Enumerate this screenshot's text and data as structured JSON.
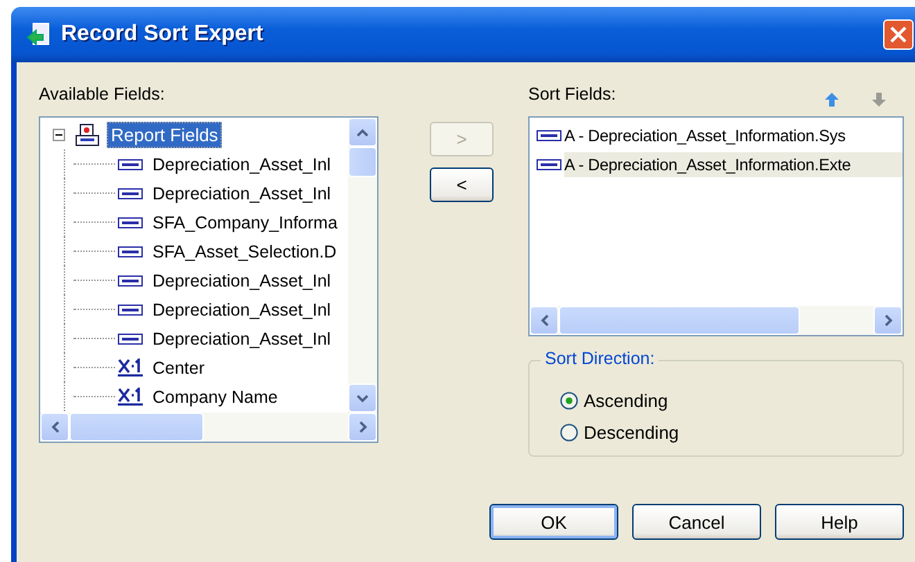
{
  "window": {
    "title": "Record Sort Expert"
  },
  "available_fields": {
    "label": "Available Fields:",
    "tree": {
      "label": "Report Fields",
      "selected": true,
      "expanded": true,
      "children": [
        {
          "label": "Depreciation_Asset_Inl",
          "kind": "field"
        },
        {
          "label": "Depreciation_Asset_Inl",
          "kind": "field"
        },
        {
          "label": "SFA_Company_Informa",
          "kind": "field"
        },
        {
          "label": "SFA_Asset_Selection.D",
          "kind": "field"
        },
        {
          "label": "Depreciation_Asset_Inl",
          "kind": "field"
        },
        {
          "label": "Depreciation_Asset_Inl",
          "kind": "field"
        },
        {
          "label": "Depreciation_Asset_Inl",
          "kind": "field"
        },
        {
          "label": "Center",
          "kind": "formula"
        },
        {
          "label": "Company Name",
          "kind": "formula"
        }
      ]
    }
  },
  "add_button": {
    "label": ">",
    "disabled": true
  },
  "remove_button": {
    "label": "<",
    "disabled": false
  },
  "sort_fields": {
    "label": "Sort Fields:",
    "move_up": {
      "disabled": false
    },
    "move_down": {
      "disabled": true
    },
    "items": [
      {
        "label": "A - Depreciation_Asset_Information.Sys",
        "selected": false
      },
      {
        "label": "A - Depreciation_Asset_Information.Exte",
        "selected": true
      }
    ]
  },
  "sort_direction": {
    "label": "Sort Direction:",
    "options": [
      {
        "label": "Ascending",
        "selected": true
      },
      {
        "label": "Descending",
        "selected": false
      }
    ]
  },
  "buttons": [
    {
      "label": "OK",
      "default": true
    },
    {
      "label": "Cancel",
      "default": false
    },
    {
      "label": "Help",
      "default": false
    }
  ]
}
